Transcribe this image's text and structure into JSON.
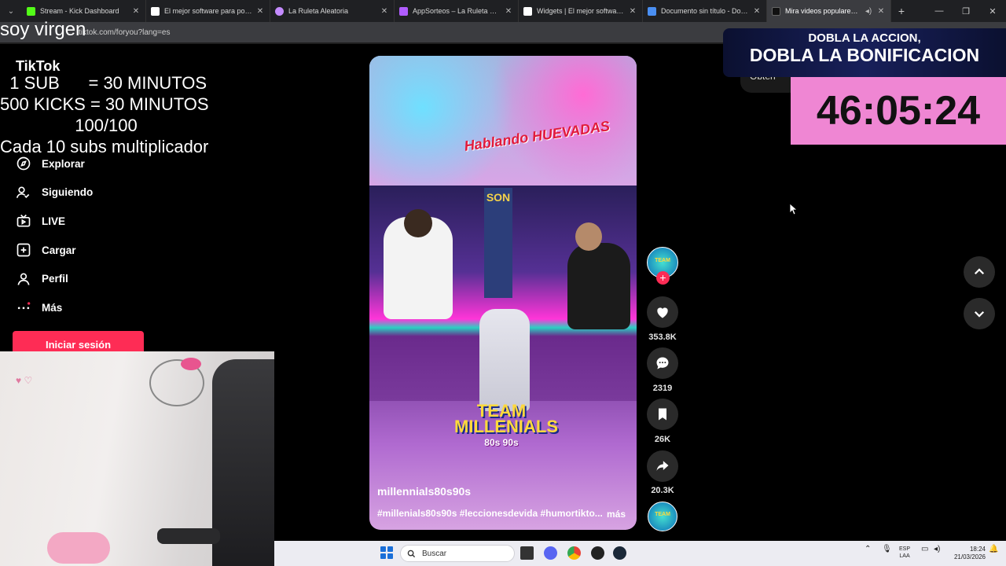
{
  "browser": {
    "tabs": [
      {
        "title": "Stream - Kick Dashboard",
        "color": "#53fc18"
      },
      {
        "title": "El mejor software para potenci",
        "color": "#ffffff"
      },
      {
        "title": "La Ruleta Aleatoria",
        "color": "#c48bff"
      },
      {
        "title": "AppSorteos – La Ruleta de la S",
        "color": "#b05cff"
      },
      {
        "title": "Widgets | El mejor software pa",
        "color": "#ffffff"
      },
      {
        "title": "Documento sin título - Docum",
        "color": "#4a8ff2"
      },
      {
        "title": "Mira videos populares sele",
        "color": "#111111",
        "active": true
      }
    ],
    "url": "tiktok.com/foryou?lang=es"
  },
  "overlay": {
    "top_text": "soy virgen",
    "line1": "  1 SUB      = 30 MINUTOS",
    "line2": "500 KICKS = 30 MINUTOS",
    "line3": "100/100",
    "line4": "Cada 10 subs multiplicador",
    "banner_line1": "DOBLA LA ACCION,",
    "banner_line2": "DOBLA LA BONIFICACION",
    "timer": "46:05:24"
  },
  "tiktok": {
    "logo": "TikTok",
    "nav": [
      {
        "label": "Explorar",
        "icon": "compass-icon"
      },
      {
        "label": "Siguiendo",
        "icon": "following-icon"
      },
      {
        "label": "LIVE",
        "icon": "live-tv-icon"
      },
      {
        "label": "Cargar",
        "icon": "upload-icon"
      },
      {
        "label": "Perfil",
        "icon": "profile-icon"
      },
      {
        "label": "Más",
        "icon": "more-dots-icon"
      }
    ],
    "login": "Iniciar sesión",
    "get_app": "Obten",
    "video": {
      "brand_text": "Hablando HUEVADAS",
      "sign_text": "SON",
      "team_logo": "TEAM MILLENIALS",
      "team_sub": "80s 90s",
      "username": "millennials80s90s",
      "tags": "#millenials80s90s #leccionesdevida #humortikto...",
      "more": "más"
    },
    "actions": {
      "likes": "353.8K",
      "comments": "2319",
      "saves": "26K",
      "shares": "20.3K"
    }
  },
  "taskbar": {
    "search_placeholder": "Buscar",
    "lang": "ESP",
    "lang2": "LAA",
    "time": "18:24",
    "date": "21/03/2026"
  }
}
